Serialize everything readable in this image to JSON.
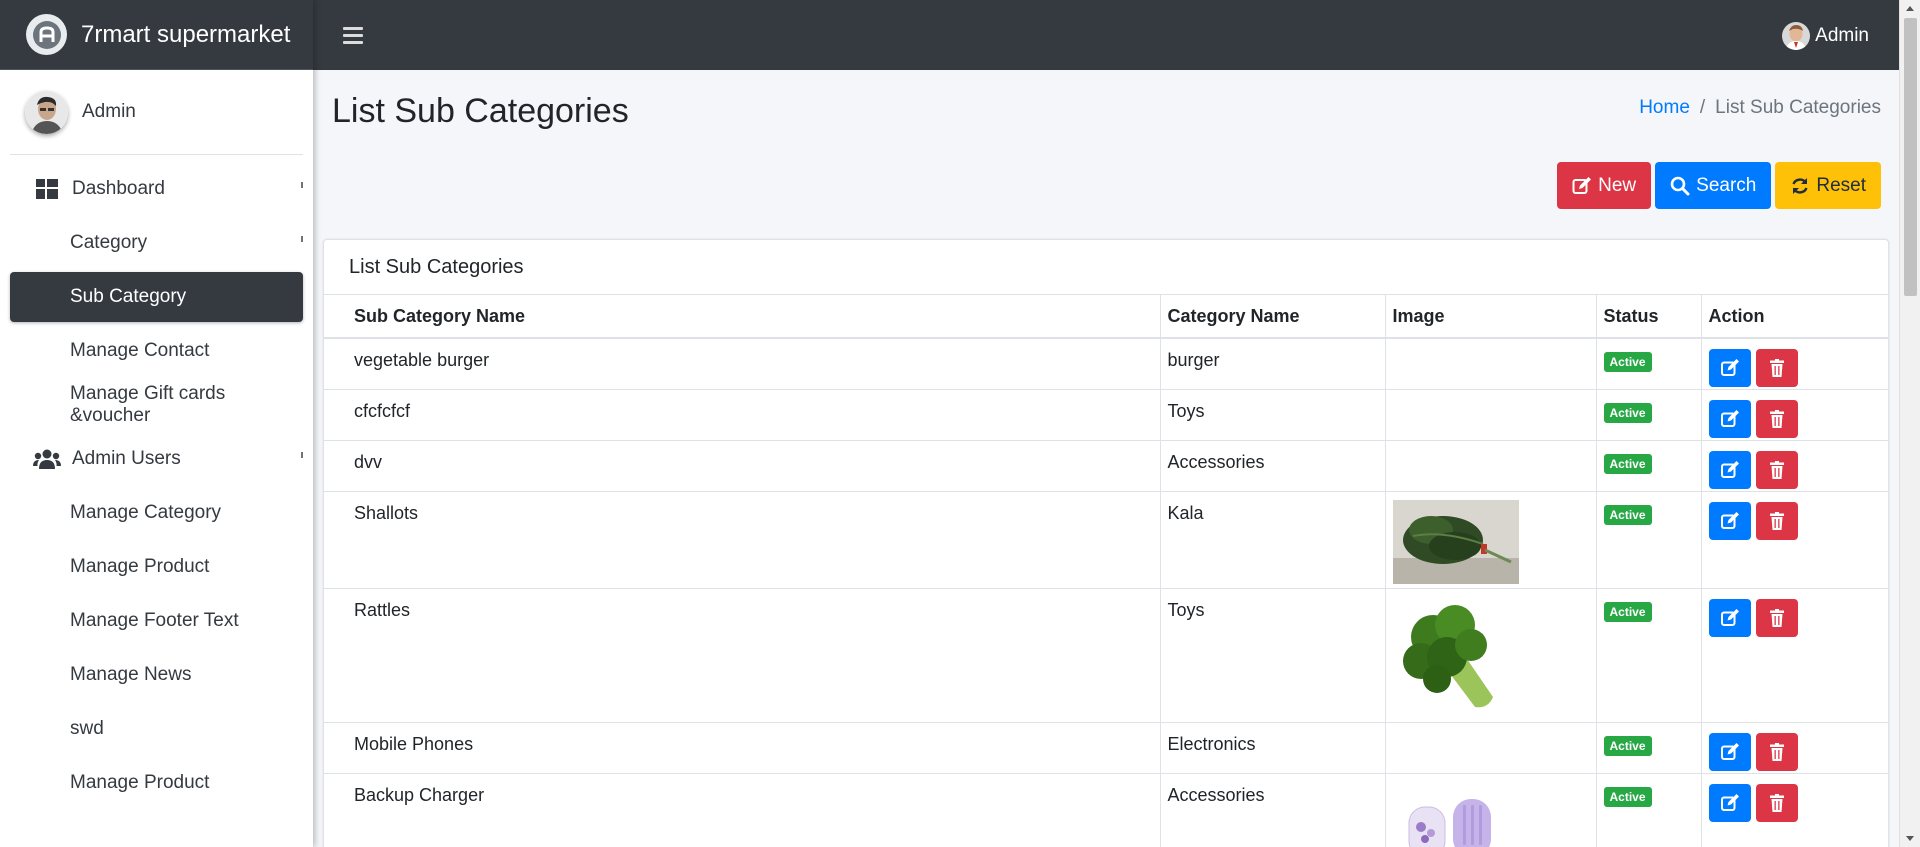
{
  "brand": {
    "name": "7rmart supermarket"
  },
  "sidebar": {
    "user_name": "Admin",
    "items": [
      {
        "label": "Dashboard"
      },
      {
        "label": "Category"
      },
      {
        "label": "Sub Category"
      },
      {
        "label": "Manage Contact"
      },
      {
        "label": "Manage Gift cards &voucher"
      },
      {
        "label": "Admin Users"
      },
      {
        "label": "Manage Category"
      },
      {
        "label": "Manage Product"
      },
      {
        "label": "Manage Footer Text"
      },
      {
        "label": "Manage News"
      },
      {
        "label": "swd"
      },
      {
        "label": "Manage Product"
      }
    ]
  },
  "topbar": {
    "user_name": "Admin"
  },
  "page": {
    "title": "List Sub Categories",
    "breadcrumb": {
      "home": "Home",
      "separator": "/",
      "current": "List Sub Categories"
    }
  },
  "buttons": {
    "new": "New",
    "search": "Search",
    "reset": "Reset"
  },
  "card": {
    "title": "List Sub Categories",
    "columns": [
      "Sub Category Name",
      "Category Name",
      "Image",
      "Status",
      "Action"
    ],
    "rows": [
      {
        "name": "vegetable burger",
        "category": "burger",
        "image": "",
        "status": "Active"
      },
      {
        "name": "cfcfcfcf",
        "category": "Toys",
        "image": "",
        "status": "Active"
      },
      {
        "name": "dvv",
        "category": "Accessories",
        "image": "",
        "status": "Active"
      },
      {
        "name": "Shallots",
        "category": "Kala",
        "image": "kale-leaves",
        "status": "Active"
      },
      {
        "name": "Rattles",
        "category": "Toys",
        "image": "broccoli",
        "status": "Active"
      },
      {
        "name": "Mobile Phones",
        "category": "Electronics",
        "image": "",
        "status": "Active"
      },
      {
        "name": "Backup Charger",
        "category": "Accessories",
        "image": "power-bank",
        "status": "Active"
      }
    ]
  },
  "colors": {
    "navbar": "#343a40",
    "primary": "#007bff",
    "danger": "#dc3545",
    "warning": "#ffc107",
    "success": "#28a745"
  }
}
